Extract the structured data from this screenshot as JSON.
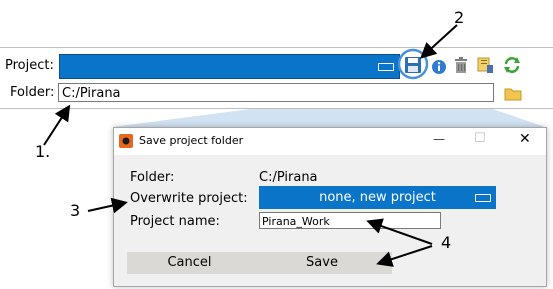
{
  "toolbar": {
    "project_label": "Project:",
    "folder_label": "Folder:",
    "folder_value": "C:/Pirana",
    "icons": [
      "save-icon",
      "info-icon",
      "trash-icon",
      "edit-note-icon",
      "refresh-icon",
      "folder-icon"
    ]
  },
  "dialog": {
    "title": "Save project folder",
    "folder_label": "Folder:",
    "folder_value": "C:/Pirana",
    "overwrite_label": "Overwrite project:",
    "overwrite_value": "none, new project",
    "name_label": "Project name:",
    "name_value": "Pirana_Work",
    "cancel_label": "Cancel",
    "save_label": "Save",
    "minimize_glyph": "—",
    "maximize_glyph": "☐",
    "close_glyph": "✕"
  },
  "callouts": {
    "c1": "1.",
    "c2": "2",
    "c3": "3",
    "c4": "4"
  },
  "colors": {
    "accent_blue": "#0a74c8",
    "highlight_circle": "#4a90d9"
  }
}
